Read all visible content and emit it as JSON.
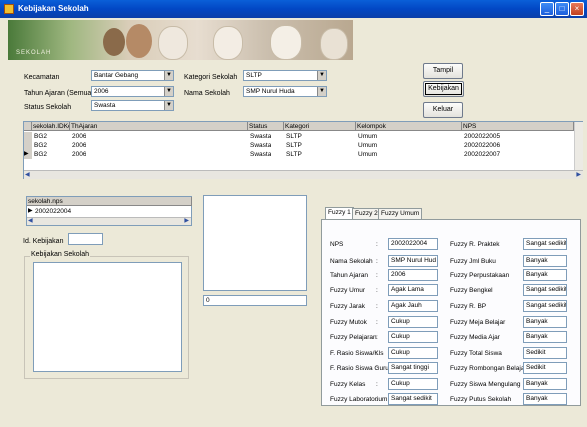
{
  "window": {
    "title": "Kebijakan Sekolah"
  },
  "banner": {
    "caption": "SEKOLAH"
  },
  "filters": {
    "kecamatan_label": "Kecamatan",
    "kecamatan_value": "Bantar Gebang",
    "tahun_label": "Tahun Ajaran (Semua)",
    "tahun_value": "2006",
    "status_label": "Status Sekolah",
    "status_value": "Swasta",
    "kategori_label": "Kategori Sekolah",
    "kategori_value": "SLTP",
    "nama_label": "Nama Sekolah",
    "nama_value": "SMP Nurul Huda"
  },
  "buttons": {
    "tampil": "Tampil",
    "kebijakan": "Kebijakan",
    "keluar": "Keluar"
  },
  "main_grid": {
    "columns": [
      "sekolah.IDKel",
      "ThAjaran",
      "Status",
      "Kategori",
      "Kelompok",
      "NPS"
    ],
    "rows": [
      [
        "BG2",
        "2006",
        "Swasta",
        "SLTP",
        "Umum",
        "2002022005"
      ],
      [
        "BG2",
        "2006",
        "Swasta",
        "SLTP",
        "Umum",
        "2002022006"
      ],
      [
        "BG2",
        "2006",
        "Swasta",
        "SLTP",
        "Umum",
        "2002022007"
      ]
    ]
  },
  "nps_grid": {
    "column": "sekolah.nps",
    "value": "2002022004"
  },
  "id_kebijakan_label": "Id. Kebijakan",
  "kebijakan_sekolah_label": "Kebijakan Sekolah",
  "counter_value": "0",
  "tabs": [
    "Fuzzy 1",
    "Fuzzy 2",
    "Fuzzy Umum"
  ],
  "fuzzy_left": [
    {
      "label": "NPS",
      "value": "2002022004"
    },
    {
      "label": "Nama Sekolah",
      "value": "SMP Nurul Hud"
    },
    {
      "label": "Tahun Ajaran",
      "value": "2006"
    },
    {
      "label": "Fuzzy Umur",
      "value": "Agak Lama"
    },
    {
      "label": "Fuzzy Jarak",
      "value": "Agak Jauh"
    },
    {
      "label": "Fuzzy Mutok",
      "value": "Cukup"
    },
    {
      "label": "Fuzzy Pelajaran",
      "value": "Cukup"
    },
    {
      "label": "F. Rasio Siswa/Kls",
      "value": "Cukup"
    },
    {
      "label": "F. Rasio Siswa Guru",
      "value": "Sangat tinggi"
    },
    {
      "label": "Fuzzy Kelas",
      "value": "Cukup"
    },
    {
      "label": "Fuzzy Laboratorium",
      "value": "Sangat sedikit"
    }
  ],
  "fuzzy_right": [
    {
      "label": "Fuzzy R. Praktek",
      "value": "Sangat sedikit"
    },
    {
      "label": "Fuzzy Jml Buku",
      "value": "Banyak"
    },
    {
      "label": "Fuzzy Perpustakaan",
      "value": "Banyak"
    },
    {
      "label": "Fuzzy Bengkel",
      "value": "Sangat sedikit"
    },
    {
      "label": "Fuzzy R. BP",
      "value": "Sangat sedikit"
    },
    {
      "label": "Fuzzy Meja Belajar",
      "value": "Banyak"
    },
    {
      "label": "Fuzzy Media Ajar",
      "value": "Banyak"
    },
    {
      "label": "Fuzzy Total Siswa",
      "value": "Sedikit"
    },
    {
      "label": "Fuzzy Rombongan Belajar",
      "value": "Sedikit"
    },
    {
      "label": "Fuzzy Siswa Mengulang",
      "value": "Banyak"
    },
    {
      "label": "Fuzzy Putus Sekolah",
      "value": "Banyak"
    }
  ],
  "colon": ":"
}
